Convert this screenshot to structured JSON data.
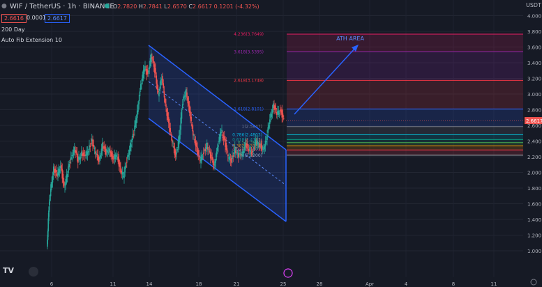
{
  "header": {
    "symbol": "WIF / TetherUS · 1h · BINANCE",
    "ohlc": [
      {
        "k": "O",
        "v": "2.7820"
      },
      {
        "k": "H",
        "v": "2.7841"
      },
      {
        "k": "L",
        "v": "2.6570"
      },
      {
        "k": "C",
        "v": "2.6617"
      }
    ],
    "change": "0.1201 (-4.32%)",
    "sell_price": "2.6616",
    "spread": "0.0001",
    "buy_price": "2.6617",
    "indicator_1": "200 Day",
    "indicator_2": "Auto Fib Extension 10",
    "currency_axis": "USDT",
    "colors": {
      "up": "#26a69a",
      "down": "#ef5350",
      "accent": "#2962ff",
      "bg": "#161a25"
    }
  },
  "chart_data": {
    "type": "candlestick",
    "pair": "WIF/USDT",
    "timeframe": "1h",
    "ylim": [
      0.9,
      4.1
    ],
    "y_ticks": [
      1.0,
      1.2,
      1.4,
      1.6,
      1.8,
      2.0,
      2.2,
      2.4,
      2.6,
      2.8,
      3.0,
      3.2,
      3.4,
      3.6,
      3.8,
      4.0
    ],
    "x_ticks": [
      "6",
      "11",
      "14",
      "18",
      "21",
      "25",
      "28",
      "Apr",
      "4",
      "8",
      "11"
    ],
    "last_price": "2.6617",
    "price_path": [
      [
        0,
        1.05
      ],
      [
        1,
        1.5
      ],
      [
        2,
        1.75
      ],
      [
        4,
        2.05
      ],
      [
        6,
        1.95
      ],
      [
        8,
        2.1
      ],
      [
        10,
        1.8
      ],
      [
        12,
        2.0
      ],
      [
        14,
        2.2
      ],
      [
        16,
        2.3
      ],
      [
        18,
        2.15
      ],
      [
        20,
        2.25
      ],
      [
        22,
        2.2
      ],
      [
        24,
        2.3
      ],
      [
        26,
        2.4
      ],
      [
        28,
        2.25
      ],
      [
        30,
        2.15
      ],
      [
        32,
        2.35
      ],
      [
        34,
        2.25
      ],
      [
        36,
        2.3
      ],
      [
        38,
        2.15
      ],
      [
        40,
        2.25
      ],
      [
        42,
        2.05
      ],
      [
        44,
        1.95
      ],
      [
        46,
        2.15
      ],
      [
        48,
        2.35
      ],
      [
        50,
        2.5
      ],
      [
        52,
        2.8
      ],
      [
        54,
        3.1
      ],
      [
        56,
        3.35
      ],
      [
        58,
        3.25
      ],
      [
        60,
        3.5
      ],
      [
        62,
        3.3
      ],
      [
        64,
        3.0
      ],
      [
        66,
        3.2
      ],
      [
        68,
        2.9
      ],
      [
        70,
        2.6
      ],
      [
        72,
        2.4
      ],
      [
        74,
        2.2
      ],
      [
        76,
        2.45
      ],
      [
        78,
        2.9
      ],
      [
        80,
        3.05
      ],
      [
        82,
        2.75
      ],
      [
        84,
        2.5
      ],
      [
        86,
        2.3
      ],
      [
        88,
        2.15
      ],
      [
        90,
        2.25
      ],
      [
        92,
        2.35
      ],
      [
        94,
        2.2
      ],
      [
        96,
        2.1
      ],
      [
        98,
        2.3
      ],
      [
        100,
        2.55
      ],
      [
        102,
        2.4
      ],
      [
        104,
        2.2
      ],
      [
        106,
        2.15
      ],
      [
        108,
        2.3
      ],
      [
        110,
        2.2
      ],
      [
        112,
        2.25
      ],
      [
        114,
        2.35
      ],
      [
        116,
        2.3
      ],
      [
        118,
        2.25
      ],
      [
        120,
        2.4
      ],
      [
        122,
        2.35
      ],
      [
        124,
        2.3
      ],
      [
        126,
        2.4
      ],
      [
        128,
        2.7
      ],
      [
        130,
        2.85
      ],
      [
        132,
        2.75
      ],
      [
        134,
        2.8
      ],
      [
        136,
        2.66
      ]
    ],
    "fib_levels": [
      {
        "ratio": "0",
        "price": 2.22,
        "label": "0(2.2200)",
        "color": "#b2b5be"
      },
      {
        "ratio": "0.236",
        "price": 2.287,
        "label": "0.236(2.2873)",
        "color": "#f23645"
      },
      {
        "ratio": "0.382",
        "price": 2.3384,
        "label": "0.382(2.3384)",
        "color": "#ff9800"
      },
      {
        "ratio": "0.5",
        "price": 2.3803,
        "label": "0.5(2.3803)",
        "color": "#4caf50"
      },
      {
        "ratio": "0.618",
        "price": 2.4193,
        "label": "0.618(2.4193)",
        "color": "#089981"
      },
      {
        "ratio": "0.786",
        "price": 2.4803,
        "label": "0.786(2.4803)",
        "color": "#00bcd4"
      },
      {
        "ratio": "1",
        "price": 2.5847,
        "label": "1(2.5847)",
        "color": "#787b86"
      },
      {
        "ratio": "1.618",
        "price": 2.8101,
        "label": "1.618(2.8101)",
        "color": "#2962ff"
      },
      {
        "ratio": "2.618",
        "price": 3.1748,
        "label": "2.618(3.1748)",
        "color": "#f23645"
      },
      {
        "ratio": "3.618",
        "price": 3.5395,
        "label": "3.618(3.5395)",
        "color": "#9c27b0"
      },
      {
        "ratio": "4.236",
        "price": 3.7649,
        "label": "4.236(3.7649)",
        "color": "#e91e63"
      }
    ],
    "annotation": "ATH AREA"
  }
}
